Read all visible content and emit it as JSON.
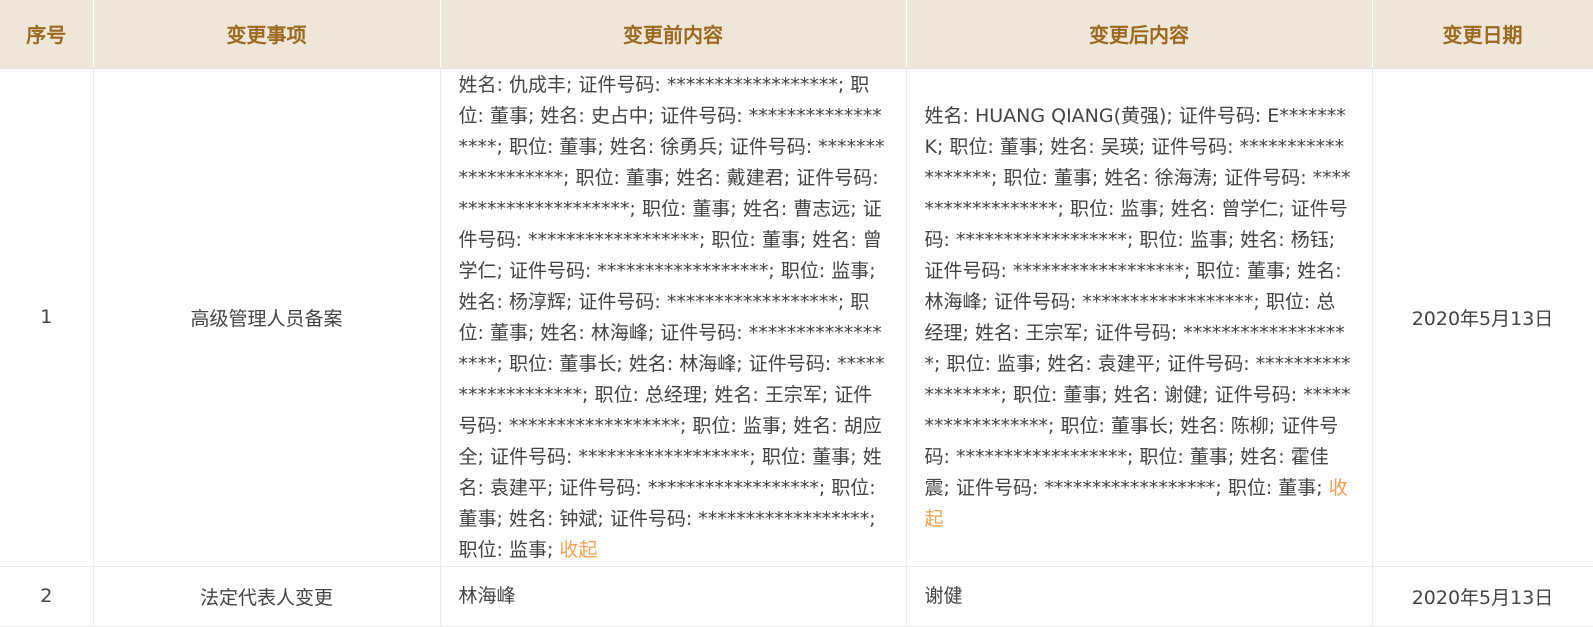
{
  "table": {
    "headers": [
      "序号",
      "变更事项",
      "变更前内容",
      "变更后内容",
      "变更日期"
    ],
    "rows": [
      {
        "no": "1",
        "item": "高级管理人员备案",
        "before": "姓名: 仇成丰; 证件号码: ******************; 职位: 董事; 姓名: 史占中; 证件号码: ******************; 职位: 董事; 姓名: 徐勇兵; 证件号码: ******************; 职位: 董事; 姓名: 戴建君; 证件号码: ******************; 职位: 董事; 姓名: 曹志远; 证件号码: ******************; 职位: 董事; 姓名: 曾学仁; 证件号码: ******************; 职位: 监事; 姓名: 杨淳辉; 证件号码: ******************; 职位: 董事; 姓名: 林海峰; 证件号码: ******************; 职位: 董事长; 姓名: 林海峰; 证件号码: ******************; 职位: 总经理; 姓名: 王宗军; 证件号码: ******************; 职位: 监事; 姓名: 胡应全; 证件号码: ******************; 职位: 董事; 姓名: 袁建平; 证件号码: ******************; 职位: 董事; 姓名: 钟斌; 证件号码: ******************; 职位: 监事; ",
        "before_link": "收起",
        "after": "姓名: HUANG QIANG(黄强); 证件号码: E*******K; 职位: 董事; 姓名: 吴瑛; 证件号码: ******************; 职位: 董事; 姓名: 徐海涛; 证件号码: ******************; 职位: 监事; 姓名: 曾学仁; 证件号码: ******************; 职位: 监事; 姓名: 杨钰; 证件号码: ******************; 职位: 董事; 姓名: 林海峰; 证件号码: ******************; 职位: 总经理; 姓名: 王宗军; 证件号码: ******************; 职位: 监事; 姓名: 袁建平; 证件号码: ******************; 职位: 董事; 姓名: 谢健; 证件号码: ******************; 职位: 董事长; 姓名: 陈柳; 证件号码: ******************; 职位: 董事; 姓名: 霍佳震; 证件号码: ******************; 职位: 董事; ",
        "after_link": "收起",
        "date": "2020年5月13日"
      },
      {
        "no": "2",
        "item": "法定代表人变更",
        "before": "林海峰",
        "after": "谢健",
        "date": "2020年5月13日"
      }
    ]
  },
  "colors": {
    "header_bg": "#efe6da",
    "header_text": "#9c6a1f",
    "body_text": "#444444",
    "link": "#f5a050"
  }
}
